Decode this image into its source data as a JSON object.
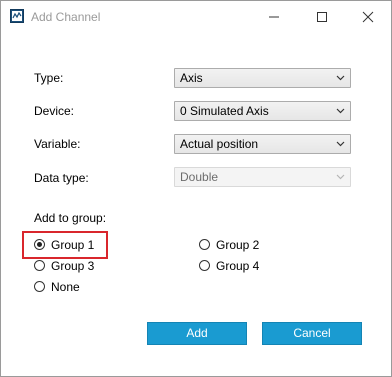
{
  "window": {
    "title": "Add Channel",
    "icons": {
      "app": "app-window-icon",
      "minimize": "minimize-icon",
      "maximize": "maximize-icon",
      "close": "close-icon"
    }
  },
  "form": {
    "type": {
      "label": "Type:",
      "value": "Axis",
      "enabled": true
    },
    "device": {
      "label": "Device:",
      "value": "0 Simulated Axis",
      "enabled": true
    },
    "variable": {
      "label": "Variable:",
      "value": "Actual position",
      "enabled": true
    },
    "data_type": {
      "label": "Data type:",
      "value": "Double",
      "enabled": false
    }
  },
  "group": {
    "label": "Add to group:",
    "options": [
      {
        "label": "Group 1",
        "selected": true
      },
      {
        "label": "Group 2",
        "selected": false
      },
      {
        "label": "Group 3",
        "selected": false
      },
      {
        "label": "Group 4",
        "selected": false
      },
      {
        "label": "None",
        "selected": false
      }
    ],
    "highlight_color": "#d9262c"
  },
  "buttons": {
    "add": "Add",
    "cancel": "Cancel",
    "color": "#1a9bd1"
  }
}
